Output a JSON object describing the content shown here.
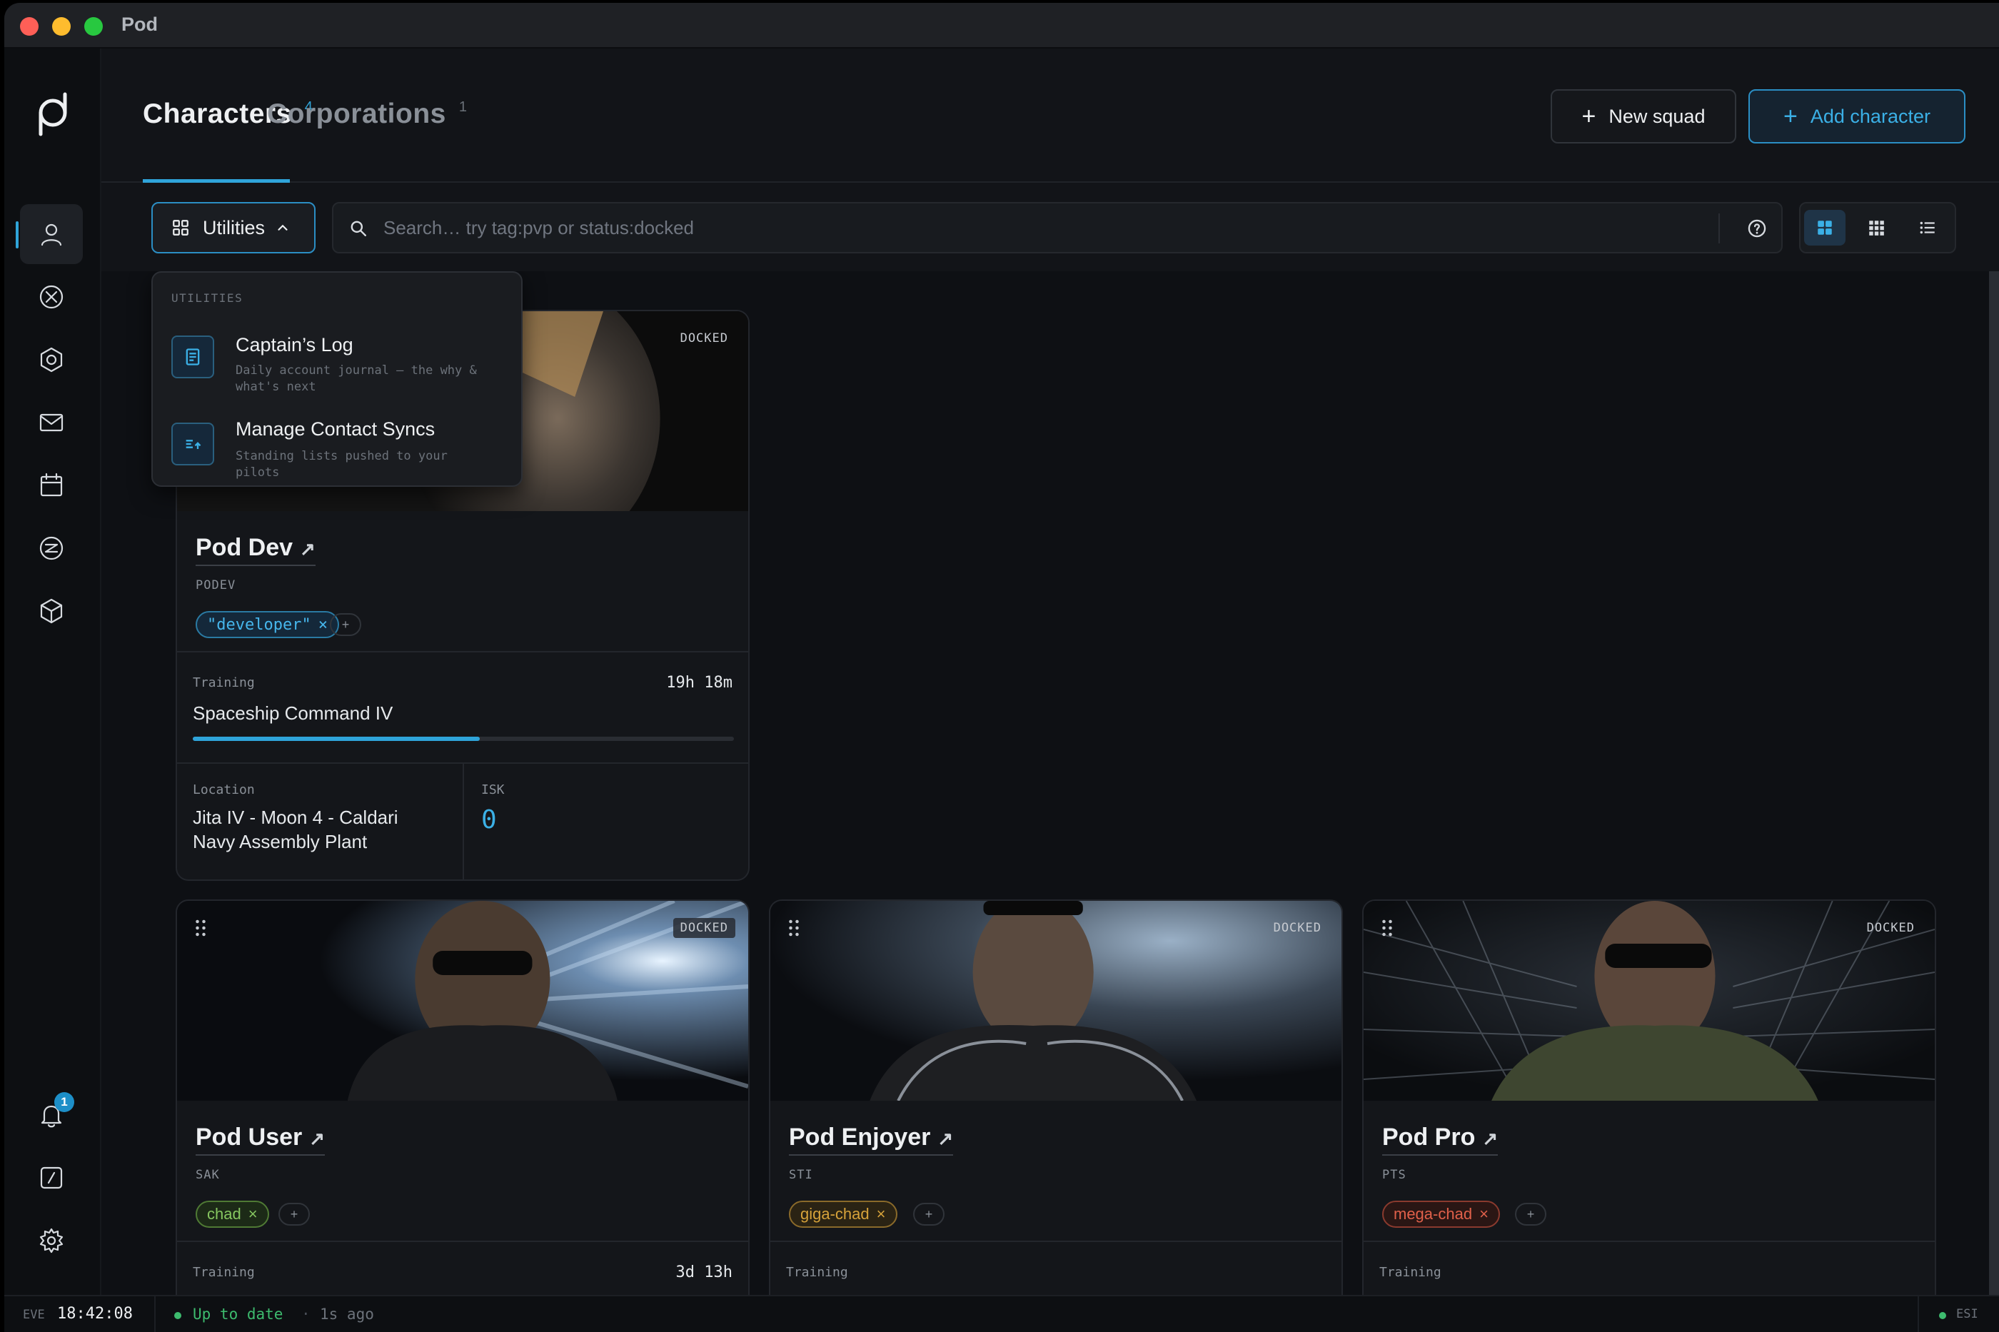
{
  "window": {
    "title": "Pod"
  },
  "header": {
    "tabs": [
      {
        "label": "Characters",
        "count": "4"
      },
      {
        "label": "Corporations",
        "count": "1"
      }
    ],
    "new_squad_label": "New squad",
    "add_character_label": "Add character"
  },
  "toolbar": {
    "utilities_label": "Utilities",
    "search_placeholder": "Search… try tag:pvp or status:docked"
  },
  "utilities_menu": {
    "heading": "UTILITIES",
    "items": [
      {
        "title": "Captain’s Log",
        "description": "Daily account journal — the why & what's next"
      },
      {
        "title": "Manage Contact Syncs",
        "description": "Standing lists pushed to your pilots"
      }
    ]
  },
  "sidebar": {
    "items": [
      "user-icon",
      "close-circle-icon",
      "hexagon-icon",
      "mail-icon",
      "calendar-icon",
      "skill-icon",
      "cube-icon"
    ],
    "bottom": [
      "bell-icon",
      "terminal-icon",
      "gear-icon"
    ],
    "notifications_count": "1"
  },
  "cards": [
    {
      "name": "Pod Dev",
      "ticker": "PODEV",
      "status": "DOCKED",
      "tag": "\"developer\"",
      "tag_color": "#2fa4d9",
      "training_label": "Training",
      "training_time": "19h 18m",
      "training_skill": "Spaceship Command IV",
      "training_progress": 0.53,
      "location_label": "Location",
      "location": "Jita IV - Moon 4 - Caldari Navy Assembly Plant",
      "isk_label": "ISK",
      "isk": "0"
    },
    {
      "name": "Pod User",
      "ticker": "SAK",
      "status": "DOCKED",
      "tag": "chad",
      "tag_color": "#7fc35a",
      "training_label": "Training",
      "training_time": "3d 13h"
    },
    {
      "name": "Pod Enjoyer",
      "ticker": "STI",
      "status": "DOCKED",
      "tag": "giga-chad",
      "tag_color": "#d6a23a",
      "training_label": "Training"
    },
    {
      "name": "Pod Pro",
      "ticker": "PTS",
      "status": "DOCKED",
      "tag": "mega-chad",
      "tag_color": "#e0604a",
      "training_label": "Training"
    }
  ],
  "statusbar": {
    "eve_label": "EVE",
    "time": "18:42:08",
    "status": "Up to date",
    "ago": "1s ago",
    "esi_label": "ESI"
  },
  "colors": {
    "accent": "#2fa4d9",
    "background": "#0e1014",
    "ok": "#3dbb6e"
  }
}
